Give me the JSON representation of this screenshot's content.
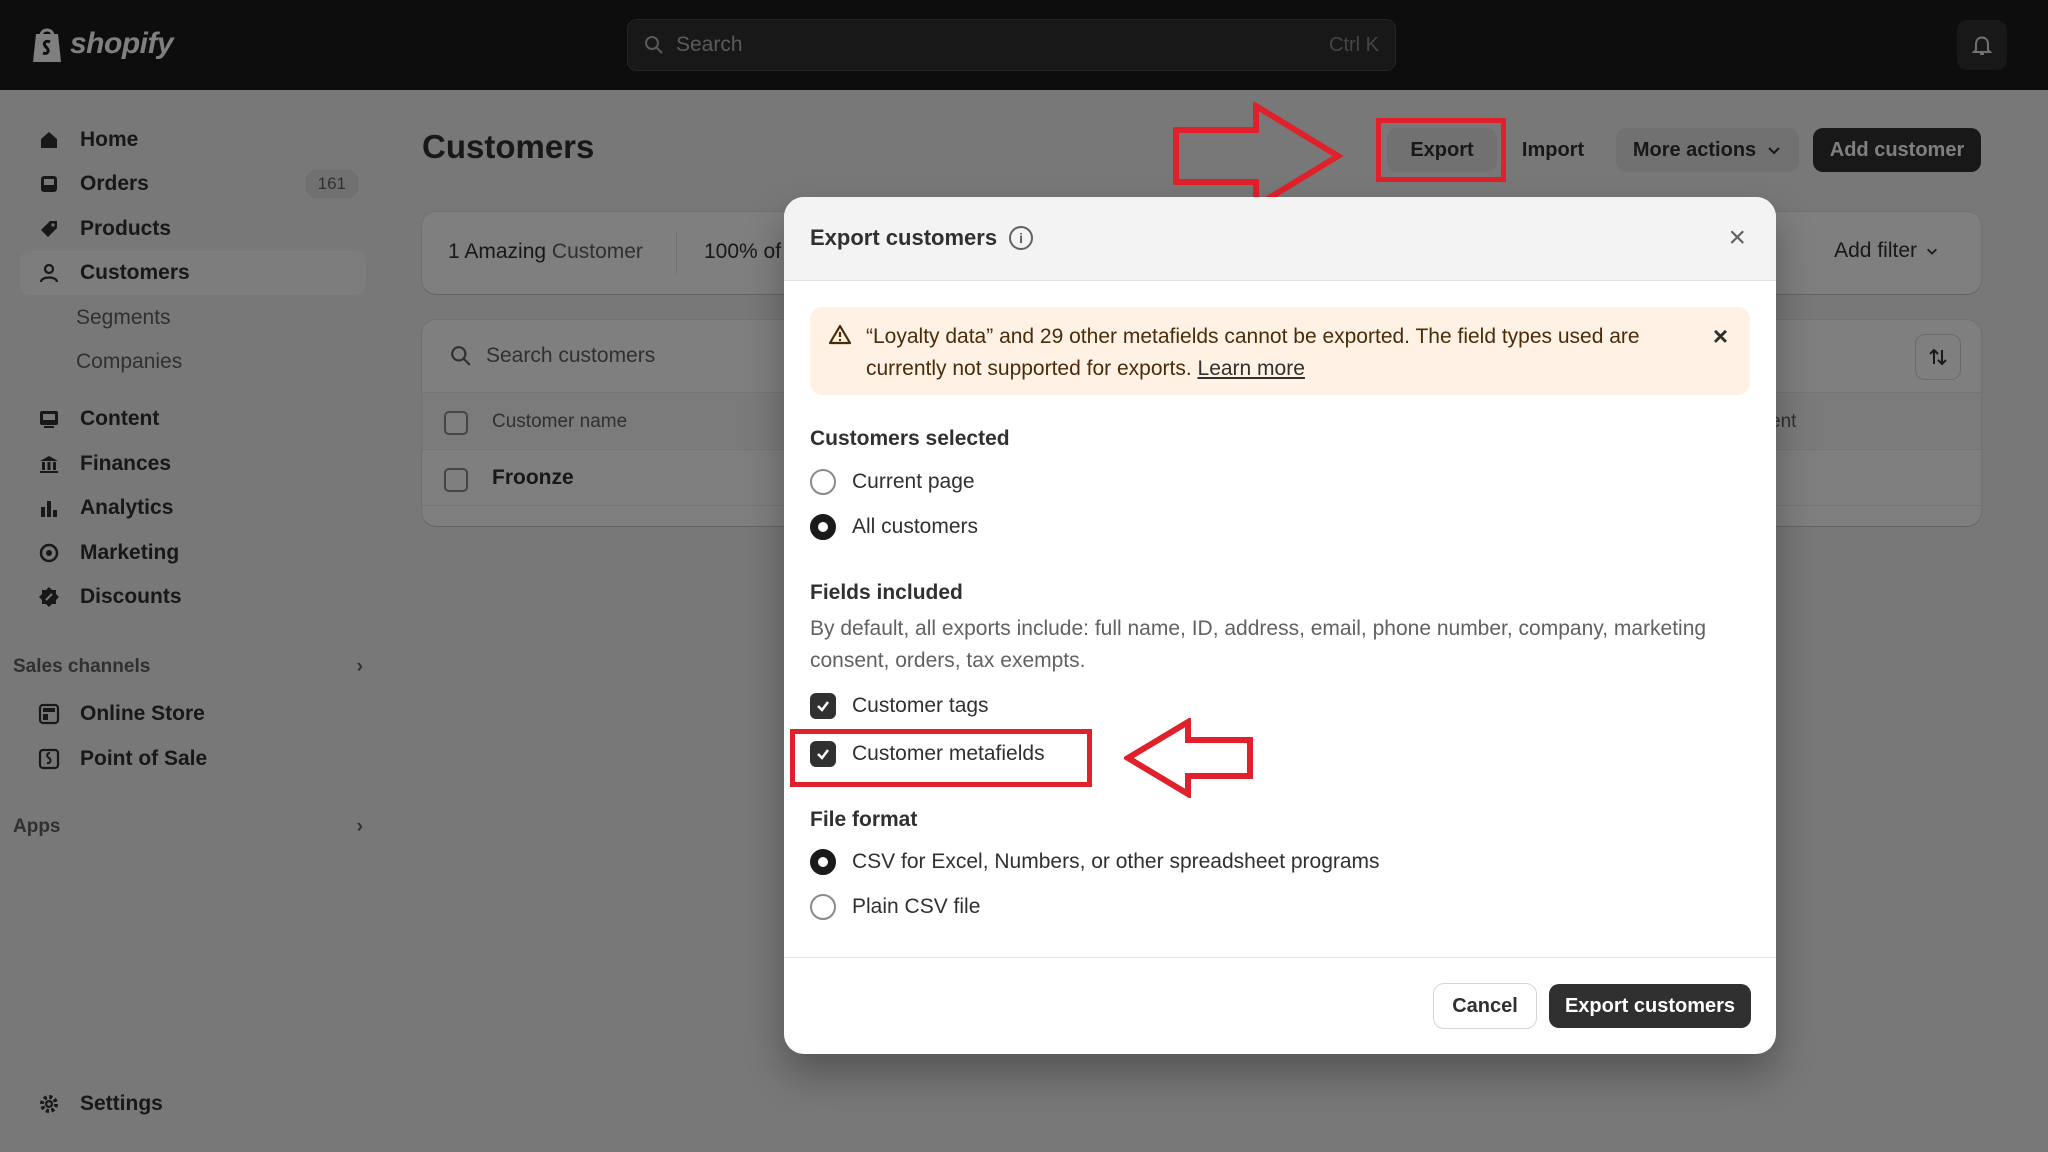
{
  "topbar": {
    "brand": "shopify",
    "search_placeholder": "Search",
    "search_shortcut": "Ctrl K"
  },
  "sidebar": {
    "items": [
      {
        "label": "Home",
        "icon": "home-icon"
      },
      {
        "label": "Orders",
        "icon": "inbox-icon",
        "badge": "161"
      },
      {
        "label": "Products",
        "icon": "tag-icon"
      },
      {
        "label": "Customers",
        "icon": "person-icon",
        "active": true
      },
      {
        "label": "Segments"
      },
      {
        "label": "Companies"
      },
      {
        "label": "Content",
        "icon": "image-icon"
      },
      {
        "label": "Finances",
        "icon": "bank-icon"
      },
      {
        "label": "Analytics",
        "icon": "bar-chart-icon"
      },
      {
        "label": "Marketing",
        "icon": "target-icon"
      },
      {
        "label": "Discounts",
        "icon": "discount-icon"
      }
    ],
    "sales_channels_label": "Sales channels",
    "channels": [
      {
        "label": "Online Store",
        "icon": "store-icon"
      },
      {
        "label": "Point of Sale",
        "icon": "pos-icon"
      }
    ],
    "apps_label": "Apps",
    "settings_label": "Settings"
  },
  "page": {
    "title": "Customers",
    "export_label": "Export",
    "import_label": "Import",
    "more_actions_label": "More actions",
    "add_customer_label": "Add customer",
    "stats": {
      "segment_count": "1 Amazing",
      "segment_suffix": " Customer",
      "percent": "100% of"
    },
    "add_filter_label": "Add filter",
    "table": {
      "search_placeholder": "Search customers",
      "col_name": "Customer name",
      "col_right_partial": "ent",
      "rows": [
        {
          "name": "Froonze"
        }
      ]
    }
  },
  "modal": {
    "title": "Export customers",
    "banner_text": "“Loyalty data” and 29 other metafields cannot be exported. The field types used are currently not supported for exports.",
    "banner_link": "Learn more",
    "customers_selected_title": "Customers selected",
    "opt_current_page": "Current page",
    "opt_all_customers": "All customers",
    "selected_customers_option": "All customers",
    "fields_title": "Fields included",
    "fields_help": "By default, all exports include: full name, ID, address, email, phone number, company, marketing consent, orders, tax exempts.",
    "field_tags": "Customer tags",
    "field_tags_checked": true,
    "field_metafields": "Customer metafields",
    "field_metafields_checked": true,
    "file_format_title": "File format",
    "fmt_csv_excel": "CSV for Excel, Numbers, or other spreadsheet programs",
    "fmt_plain_csv": "Plain CSV file",
    "selected_format": "CSV for Excel, Numbers, or other spreadsheet programs",
    "cancel_label": "Cancel",
    "export_label": "Export customers"
  },
  "colors": {
    "topbar": "#1a1a1a",
    "primary_button": "#303030",
    "annotation_red": "#e0202a",
    "banner_bg": "#fff1e3"
  }
}
